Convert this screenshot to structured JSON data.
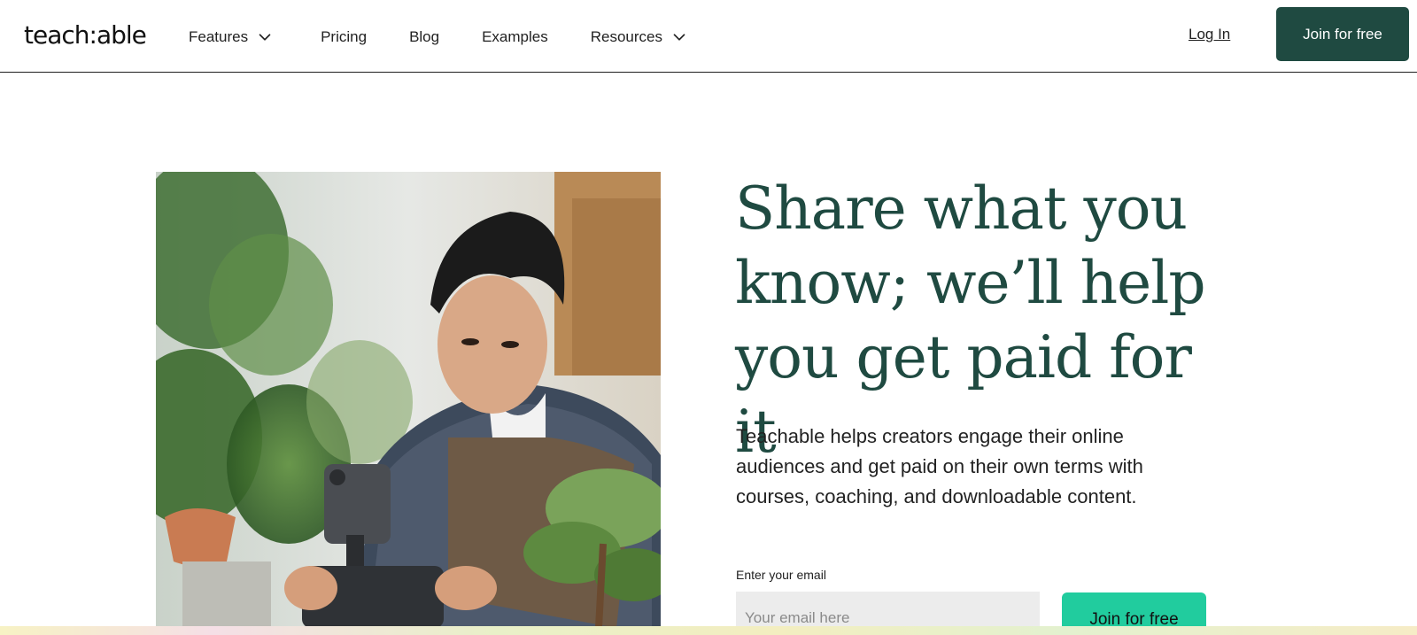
{
  "brand": {
    "logo_text": "teach:able"
  },
  "nav": {
    "items": [
      {
        "label": "Features",
        "has_dropdown": true
      },
      {
        "label": "Pricing",
        "has_dropdown": false
      },
      {
        "label": "Blog",
        "has_dropdown": false
      },
      {
        "label": "Examples",
        "has_dropdown": false
      },
      {
        "label": "Resources",
        "has_dropdown": true
      }
    ],
    "login_label": "Log In",
    "cta_label": "Join for free"
  },
  "hero": {
    "headline": "Share what you know; we’ll help you get paid for it",
    "subtext": "Teachable helps creators engage their online audiences and get paid on their own terms with courses, coaching, and downloadable content.",
    "email_label": "Enter your email",
    "email_placeholder": "Your email here",
    "email_value": "",
    "cta_label": "Join for free"
  },
  "colors": {
    "brand_dark_green": "#1f4a41",
    "cta_mint": "#21cc9e",
    "input_bg": "#ececec"
  },
  "icons": {
    "dropdown": "chevron-down-icon"
  }
}
